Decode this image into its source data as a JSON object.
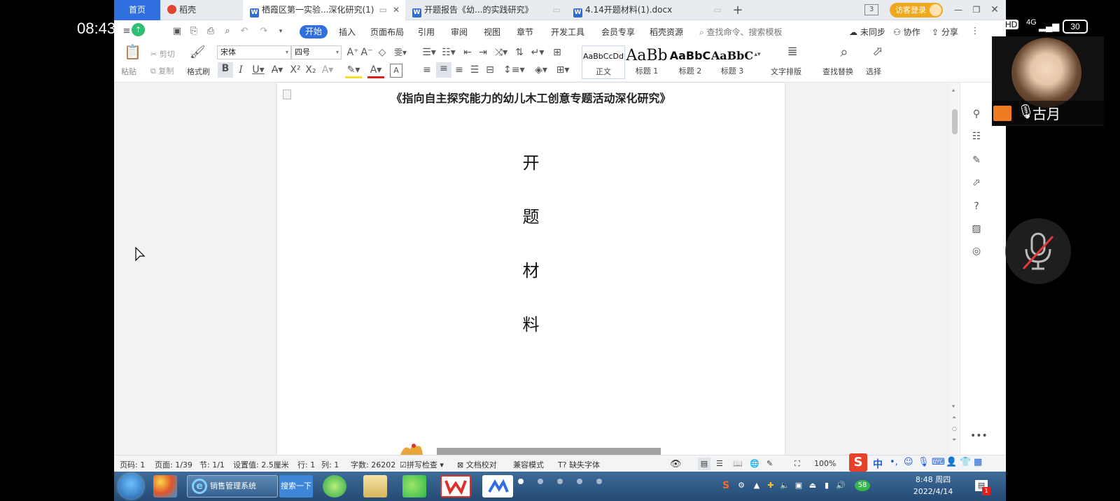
{
  "phone": {
    "time": "08:43",
    "status_icons": [
      "HD",
      "4G",
      "30"
    ],
    "participant_name": "古月"
  },
  "tabs": {
    "home": "首页",
    "items": [
      {
        "label": "稻壳",
        "icon": "docer-icon"
      },
      {
        "label": "栖霞区第一实验...深化研究(1)",
        "icon": "wps-writer-icon",
        "active": true
      },
      {
        "label": "开题报告《幼...的实践研究》",
        "icon": "wps-writer-icon"
      },
      {
        "label": "4.14开题材料(1).docx",
        "icon": "wps-writer-icon"
      }
    ],
    "window_count": "3",
    "guest_login": "访客登录"
  },
  "menu": {
    "items": [
      "开始",
      "插入",
      "页面布局",
      "引用",
      "审阅",
      "视图",
      "章节",
      "开发工具",
      "会员专享",
      "稻壳资源"
    ],
    "active": "开始",
    "search_placeholder": "查找命令、搜索模板",
    "sync": "未同步",
    "collab": "协作",
    "share": "分享"
  },
  "ribbon": {
    "paste": "粘贴",
    "cut": "剪切",
    "copy": "复制",
    "format_painter": "格式刷",
    "font_name": "宋体",
    "font_size": "四号",
    "styles": [
      {
        "preview": "AaBbCcDd",
        "label": "正文"
      },
      {
        "preview": "AaBb",
        "label": "标题 1"
      },
      {
        "preview": "AaBbC",
        "label": "标题 2"
      },
      {
        "preview": "AaBbC",
        "label": "标题 3"
      }
    ],
    "text_layout": "文字排版",
    "find_replace": "查找替换",
    "select": "选择"
  },
  "document": {
    "header": "《指向自主探究能力的幼儿木工创意专题活动深化研究》",
    "title_chars": [
      "开",
      "题",
      "材",
      "料"
    ]
  },
  "statusbar": {
    "page_no": "页码: 1",
    "pages": "页面: 1/39",
    "section": "节: 1/1",
    "setting": "设置值: 2.5厘米",
    "row": "行: 1",
    "col": "列: 1",
    "word_count": "字数: 26202",
    "spell_check": "拼写检查",
    "doc_proof": "文档校对",
    "compat_mode": "兼容模式",
    "missing_fonts": "缺失字体",
    "zoom": "100%"
  },
  "ime": {
    "mode": "中"
  },
  "taskbar": {
    "ie_label": "销售管理系统",
    "search_button": "搜索一下",
    "tray_badge": "58",
    "time": "8:48 周四",
    "date": "2022/4/14"
  }
}
